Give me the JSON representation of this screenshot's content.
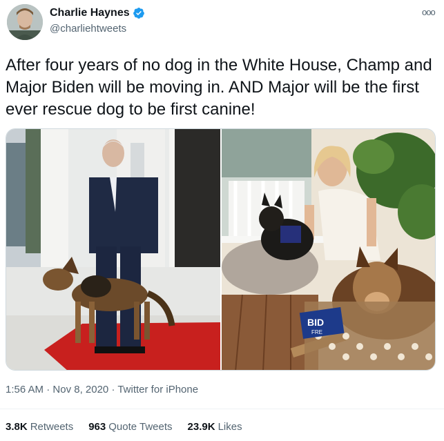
{
  "header": {
    "display_name": "Charlie Haynes",
    "handle": "@charliehtweets",
    "more_label": "ooo"
  },
  "tweet": {
    "text": "After four years of no dog in the White House, Champ and Major Biden will be moving in. AND Major will be the first ever rescue dog to be first canine!"
  },
  "media": {
    "right_photo_bag_text": "BID",
    "right_photo_bag_text2": "FRE"
  },
  "meta": {
    "time": "1:56 AM",
    "separator": " · ",
    "date": "Nov 8, 2020",
    "source": "Twitter for iPhone"
  },
  "stats": {
    "retweets_count": "3.8K",
    "retweets_label": "Retweets",
    "quotes_count": "963",
    "quotes_label": "Quote Tweets",
    "likes_count": "23.9K",
    "likes_label": "Likes"
  },
  "colors": {
    "verified": "#1d9bf0",
    "muted_text": "#536471",
    "primary_text": "#0f1419"
  }
}
